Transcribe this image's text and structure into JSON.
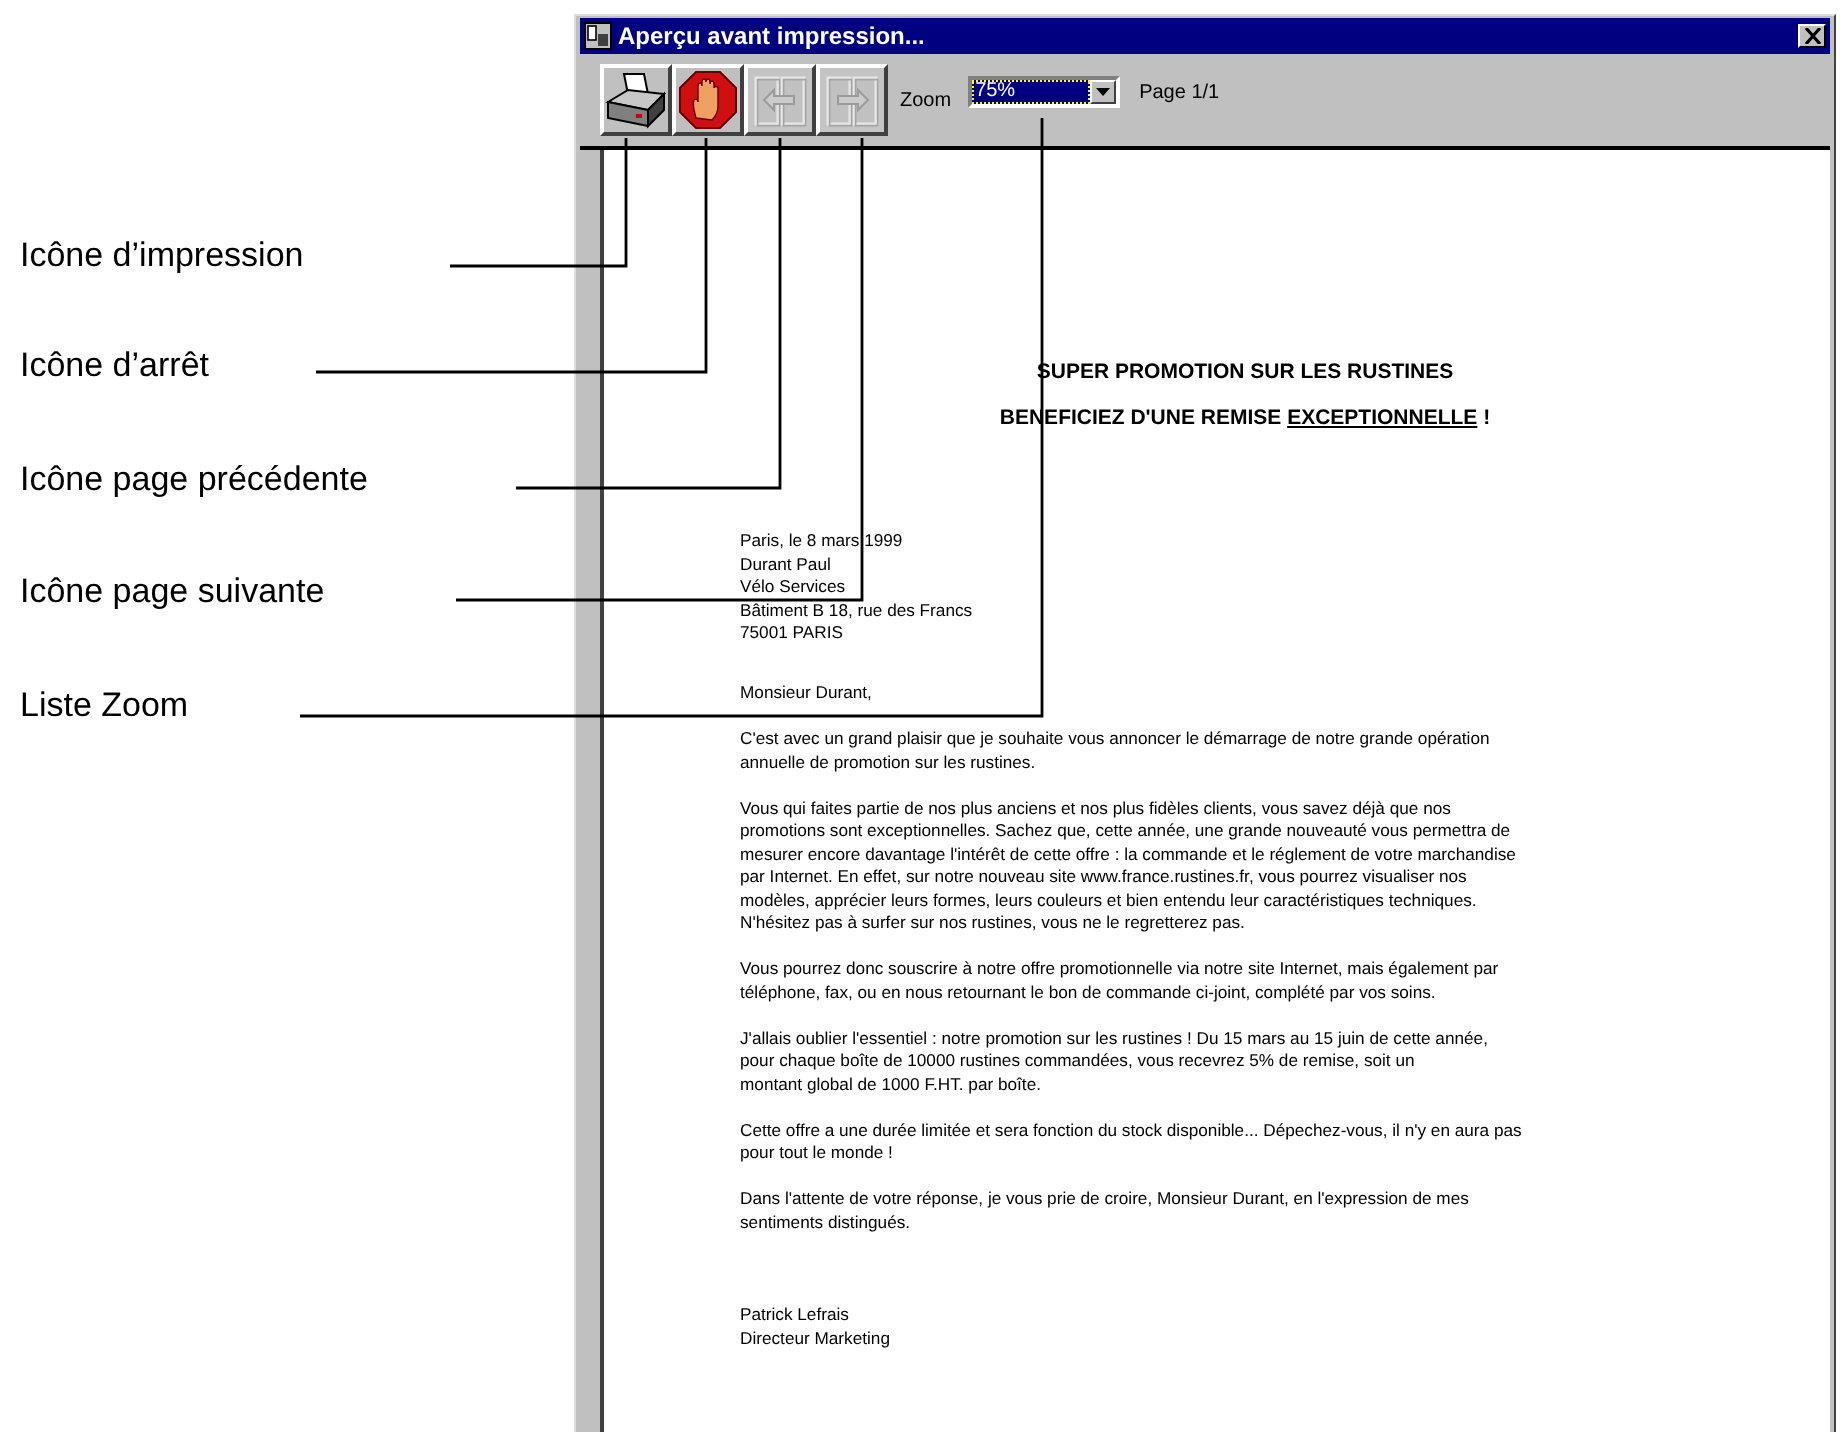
{
  "callouts": [
    {
      "label": "Icône d’impression"
    },
    {
      "label": "Icône d’arrêt"
    },
    {
      "label": "Icône page précédente"
    },
    {
      "label": "Icône page suivante"
    },
    {
      "label": "Liste Zoom"
    }
  ],
  "window": {
    "title": "Aperçu avant impression..."
  },
  "toolbar": {
    "buttons": [
      {
        "kind": "print",
        "disabled": false
      },
      {
        "kind": "stop",
        "disabled": false
      },
      {
        "kind": "previous",
        "disabled": true
      },
      {
        "kind": "next",
        "disabled": true
      }
    ],
    "zoom_label": "Zoom",
    "zoom_value": "75%",
    "page_label": "Page 1/1"
  },
  "document": {
    "heading": [
      [
        {
          "text": "SUPER PROMOTION SUR LES RUSTINES",
          "underline": false
        }
      ],
      [
        {
          "text": "BENEFICIEZ D'UNE REMISE ",
          "underline": false
        },
        {
          "text": "EXCEPTIONNELLE",
          "underline": true
        },
        {
          "text": " !",
          "underline": false
        }
      ]
    ],
    "address": [
      "Paris, le 8 mars 1999",
      "Durant Paul",
      "Vélo Services",
      "Bâtiment B 18, rue des Francs",
      "75001 PARIS"
    ],
    "salutation": "Monsieur Durant,",
    "paragraphs": [
      [
        "C'est avec un grand plaisir que je souhaite vous annoncer le démarrage de notre grande opération",
        "annuelle de promotion sur les rustines."
      ],
      [
        "Vous qui faites partie de nos plus anciens et nos plus fidèles clients, vous savez déjà que nos",
        "promotions sont exceptionnelles. Sachez que, cette année, une grande nouveauté vous permettra de",
        "mesurer encore davantage l'intérêt de cette offre : la commande et le réglement de votre marchandise",
        "par Internet. En effet, sur notre nouveau site www.france.rustines.fr, vous pourrez visualiser nos",
        "modèles, apprécier leurs formes, leurs couleurs et bien entendu leur caractéristiques techniques.",
        "N'hésitez pas à surfer sur nos rustines, vous ne le regretterez pas."
      ],
      [
        "Vous pourrez donc souscrire à notre offre promotionnelle via notre site Internet, mais également par",
        "téléphone, fax, ou en nous retournant le bon de commande ci-joint, complété par vos soins."
      ],
      [
        "J'allais oublier l'essentiel : notre promotion sur les rustines ! Du 15 mars au 15 juin de cette année,",
        "pour chaque boîte de 10000 rustines commandées, vous recevrez 5% de remise, soit un",
        "montant global de 1000 F.HT. par boîte."
      ],
      [
        "Cette offre a une durée limitée et sera fonction du stock disponible... Dépechez-vous, il n'y en aura pas",
        "pour tout le monde !"
      ],
      [
        "Dans l'attente de votre réponse, je vous prie de croire, Monsieur Durant, en l'expression de mes",
        "sentiments distingués."
      ]
    ],
    "signature": [
      "Patrick Lefrais",
      "Directeur Marketing"
    ]
  }
}
